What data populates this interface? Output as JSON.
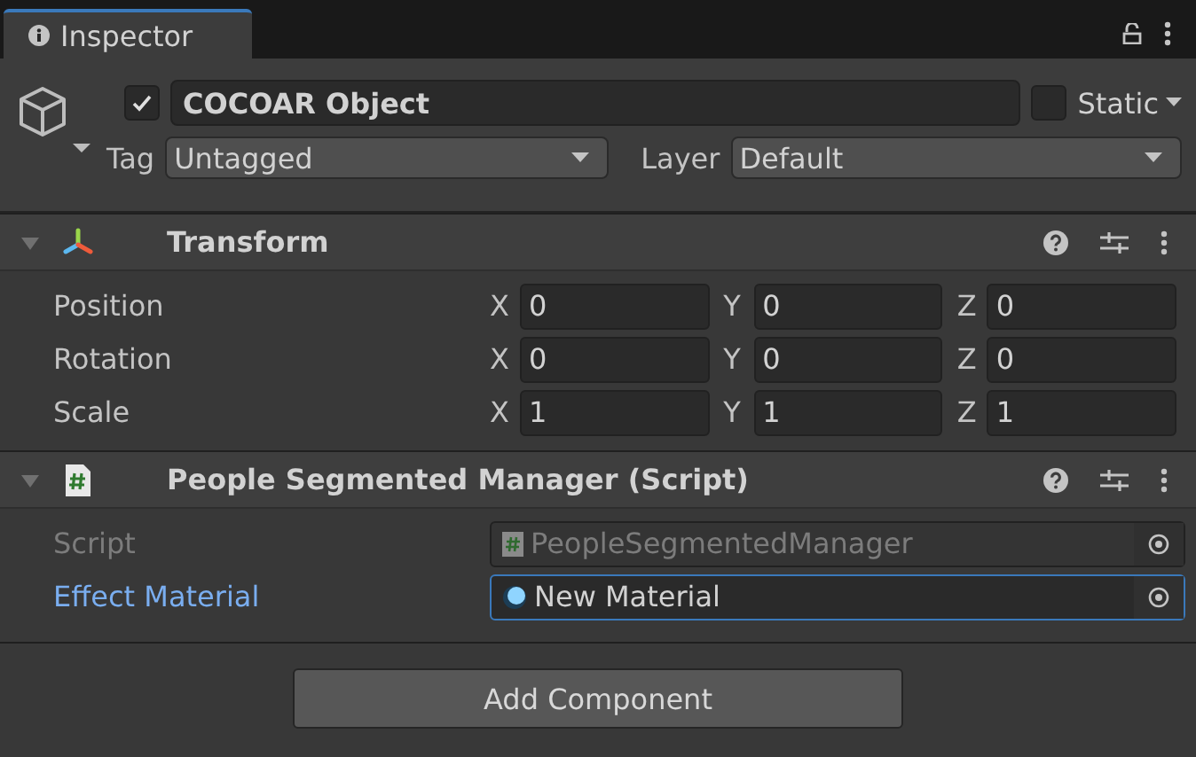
{
  "tab": {
    "label": "Inspector",
    "selected": true
  },
  "object": {
    "active": true,
    "name": "COCOAR Object",
    "static": {
      "label": "Static",
      "checked": false
    },
    "tag": {
      "label": "Tag",
      "value": "Untagged"
    },
    "layer": {
      "label": "Layer",
      "value": "Default"
    }
  },
  "components": [
    {
      "kind": "transform",
      "title": "Transform",
      "expanded": true,
      "rows": [
        {
          "label": "Position",
          "values": [
            {
              "axis": "X",
              "value": "0"
            },
            {
              "axis": "Y",
              "value": "0"
            },
            {
              "axis": "Z",
              "value": "0"
            }
          ]
        },
        {
          "label": "Rotation",
          "values": [
            {
              "axis": "X",
              "value": "0"
            },
            {
              "axis": "Y",
              "value": "0"
            },
            {
              "axis": "Z",
              "value": "0"
            }
          ]
        },
        {
          "label": "Scale",
          "values": [
            {
              "axis": "X",
              "value": "1"
            },
            {
              "axis": "Y",
              "value": "1"
            },
            {
              "axis": "Z",
              "value": "1"
            }
          ]
        }
      ]
    },
    {
      "kind": "script",
      "title": "People Segmented Manager (Script)",
      "expanded": true,
      "fields": [
        {
          "kind": "script",
          "label": "Script",
          "value": "PeopleSegmentedManager",
          "disabled": true,
          "selected": false
        },
        {
          "kind": "material",
          "label": "Effect Material",
          "value": "New Material",
          "disabled": false,
          "selected": true
        }
      ]
    }
  ],
  "add_button": "Add Component"
}
